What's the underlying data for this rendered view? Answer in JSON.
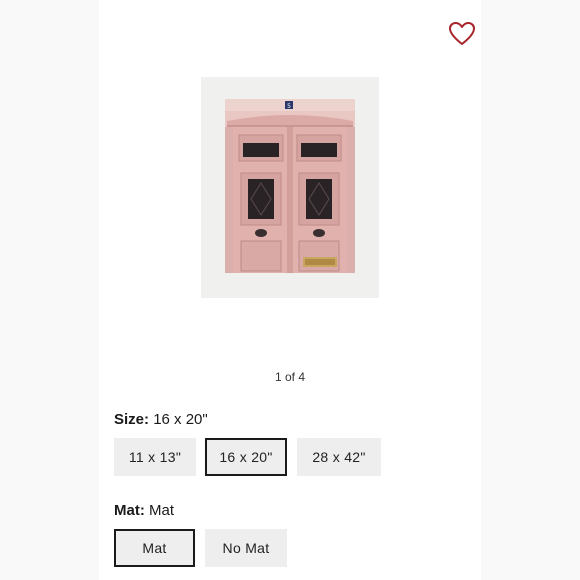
{
  "gallery": {
    "pager_text": "1 of 4",
    "image_alt": "Pink Parisian doors with mat",
    "door_number": "5"
  },
  "favorite": {
    "icon": "heart-outline-icon",
    "color": "#a8252c"
  },
  "size": {
    "label": "Size:",
    "selected_value": "16 x 20\"",
    "options": [
      {
        "label": "11 x 13\"",
        "selected": false
      },
      {
        "label": "16 x 20\"",
        "selected": true
      },
      {
        "label": "28 x 42\"",
        "selected": false
      }
    ]
  },
  "mat": {
    "label": "Mat:",
    "selected_value": "Mat",
    "options": [
      {
        "label": "Mat",
        "selected": true
      },
      {
        "label": "No Mat",
        "selected": false
      }
    ]
  },
  "colors": {
    "door_pink": "#e4bdbb",
    "selected_border": "#1a1a1a",
    "option_bg": "#eeeeee",
    "mat_bg": "#f0f0ef"
  }
}
